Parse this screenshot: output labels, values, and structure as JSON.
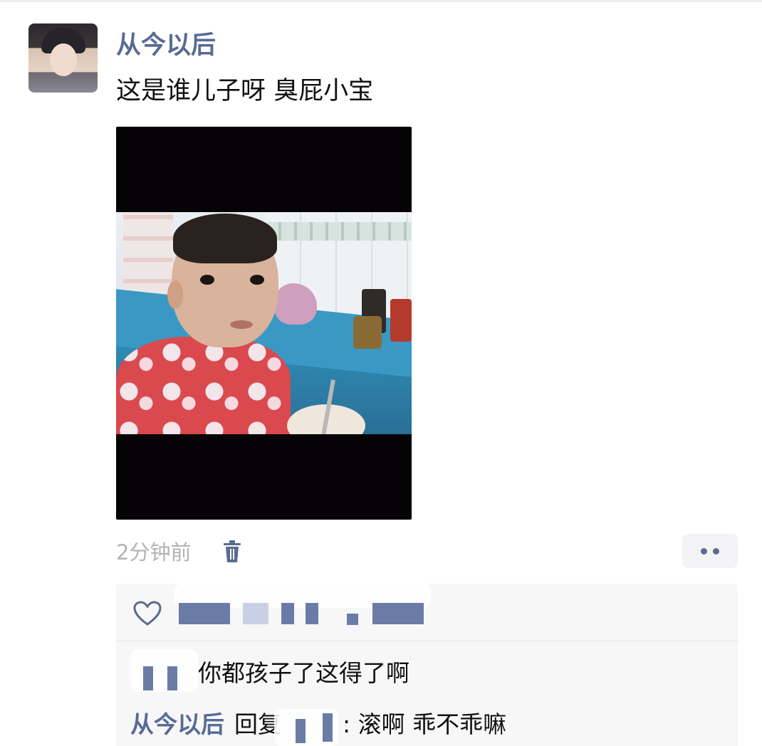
{
  "post": {
    "author": "从今以后",
    "text": "这是谁儿子呀 臭屁小宝",
    "time": "2分钟前"
  },
  "icons": {
    "avatar": "user-avatar",
    "delete": "trash-icon",
    "more": "more-dots-icon",
    "like": "heart-icon"
  },
  "comments": {
    "comment1_text": "你都孩子了这得了啊",
    "comment2_author": "从今以后",
    "comment2_reply_word": "回复",
    "comment2_text": ": 滚啊 乖不乖嘛"
  },
  "colors": {
    "link": "#576b95",
    "muted": "#b2b2b2",
    "comment_bg": "#f7f7f7"
  }
}
